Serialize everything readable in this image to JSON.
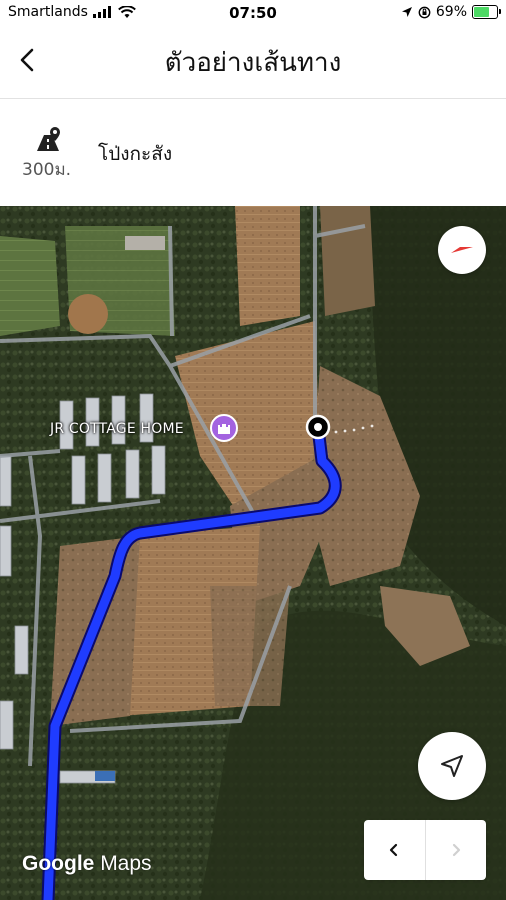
{
  "status_bar": {
    "carrier": "Smartlands",
    "time": "07:50",
    "battery_percent": "69%",
    "icons": [
      "signal-icon",
      "wifi-icon",
      "location-arrow-icon",
      "orientation-lock-icon",
      "battery-charging-icon"
    ]
  },
  "header": {
    "title": "ตัวอย่างเส้นทาง",
    "back_icon": "chevron-left-icon"
  },
  "route": {
    "distance": "300ม.",
    "destination": "โป่งกะสัง",
    "icon": "road-pin-icon"
  },
  "map": {
    "poi_label": "JR COTTAGE HOME",
    "poi_icon": "castle-icon",
    "route_color": "#1f3cff",
    "start_marker_icon": "start-point-icon",
    "compass_icon": "compass-icon",
    "locate_icon": "navigation-arrow-icon",
    "prev_step_icon": "chevron-left-icon",
    "next_step_icon": "chevron-right-icon",
    "attribution_brand": "Google",
    "attribution_product": "Maps"
  }
}
